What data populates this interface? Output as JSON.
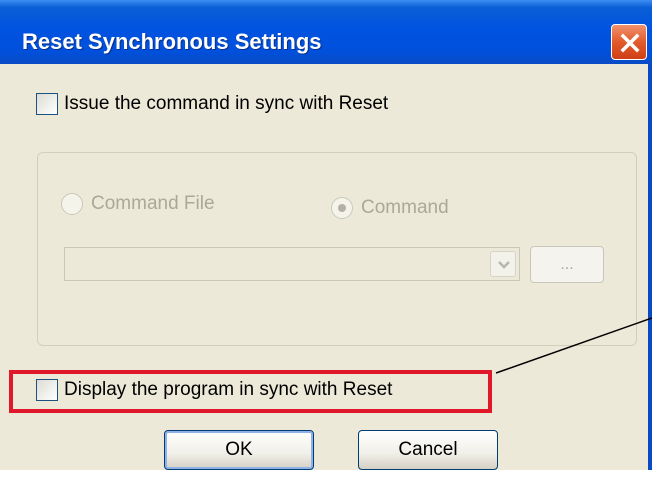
{
  "dialog": {
    "title": "Reset Synchronous Settings",
    "close_icon": "close-icon",
    "issue_command_checkbox": {
      "label": "Issue the command in sync with Reset",
      "checked": false
    },
    "command_group": {
      "radio_command_file": {
        "label": "Command File",
        "selected": false,
        "enabled": false
      },
      "radio_command": {
        "label": "Command",
        "selected": true,
        "enabled": false
      },
      "command_combo": {
        "value": "",
        "enabled": false,
        "dropdown_icon": "chevron-down-icon"
      },
      "browse_button": {
        "label": "...",
        "enabled": false
      }
    },
    "display_program_checkbox": {
      "label": "Display the program in sync with Reset",
      "checked": false
    },
    "ok_button": {
      "label": "OK"
    },
    "cancel_button": {
      "label": "Cancel"
    }
  },
  "annotation": {
    "highlight_color": "#e0192a"
  },
  "colors": {
    "titlebar": "#0053e0",
    "dialog_bg": "#ece9d8",
    "close_button": "#e35a2c",
    "disabled_text": "#aca899"
  }
}
